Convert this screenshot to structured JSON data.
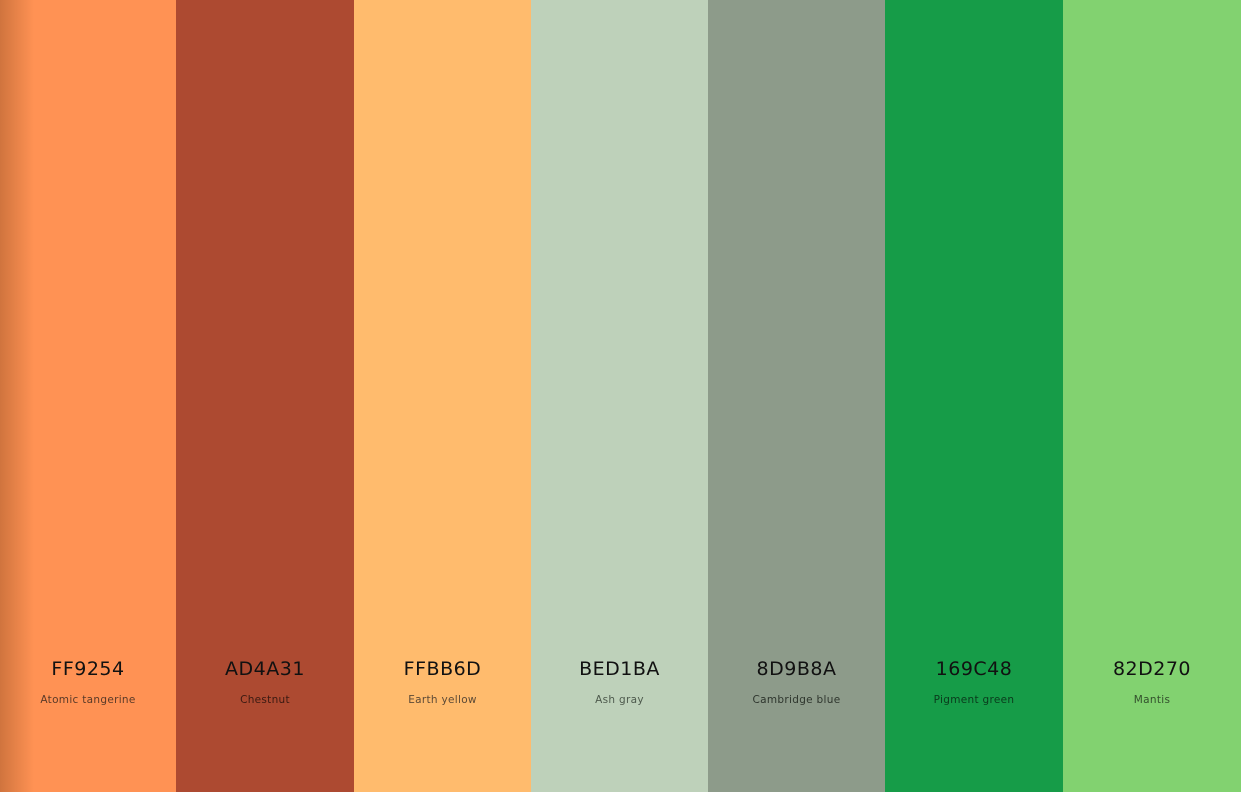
{
  "colors": [
    {
      "hex": "FF9254",
      "name": "Atomic tangerine",
      "color": "#FF9254",
      "text_color": "#111111",
      "subtext_color": "#5a3a28"
    },
    {
      "hex": "AD4A31",
      "name": "Chestnut",
      "color": "#AD4A31",
      "text_color": "#111111",
      "subtext_color": "#3a1a12"
    },
    {
      "hex": "FFBB6D",
      "name": "Earth yellow",
      "color": "#FFBB6D",
      "text_color": "#111111",
      "subtext_color": "#5c4a36"
    },
    {
      "hex": "BED1BA",
      "name": "Ash gray",
      "color": "#BED1BA",
      "text_color": "#111111",
      "subtext_color": "#4e5a4d"
    },
    {
      "hex": "8D9B8A",
      "name": "Cambridge blue",
      "color": "#8D9B8A",
      "text_color": "#111111",
      "subtext_color": "#2e352d"
    },
    {
      "hex": "169C48",
      "name": "Pigment green",
      "color": "#169C48",
      "text_color": "#111111",
      "subtext_color": "#0a3a1c"
    },
    {
      "hex": "82D270",
      "name": "Mantis",
      "color": "#82D270",
      "text_color": "#111111",
      "subtext_color": "#33502d"
    }
  ]
}
